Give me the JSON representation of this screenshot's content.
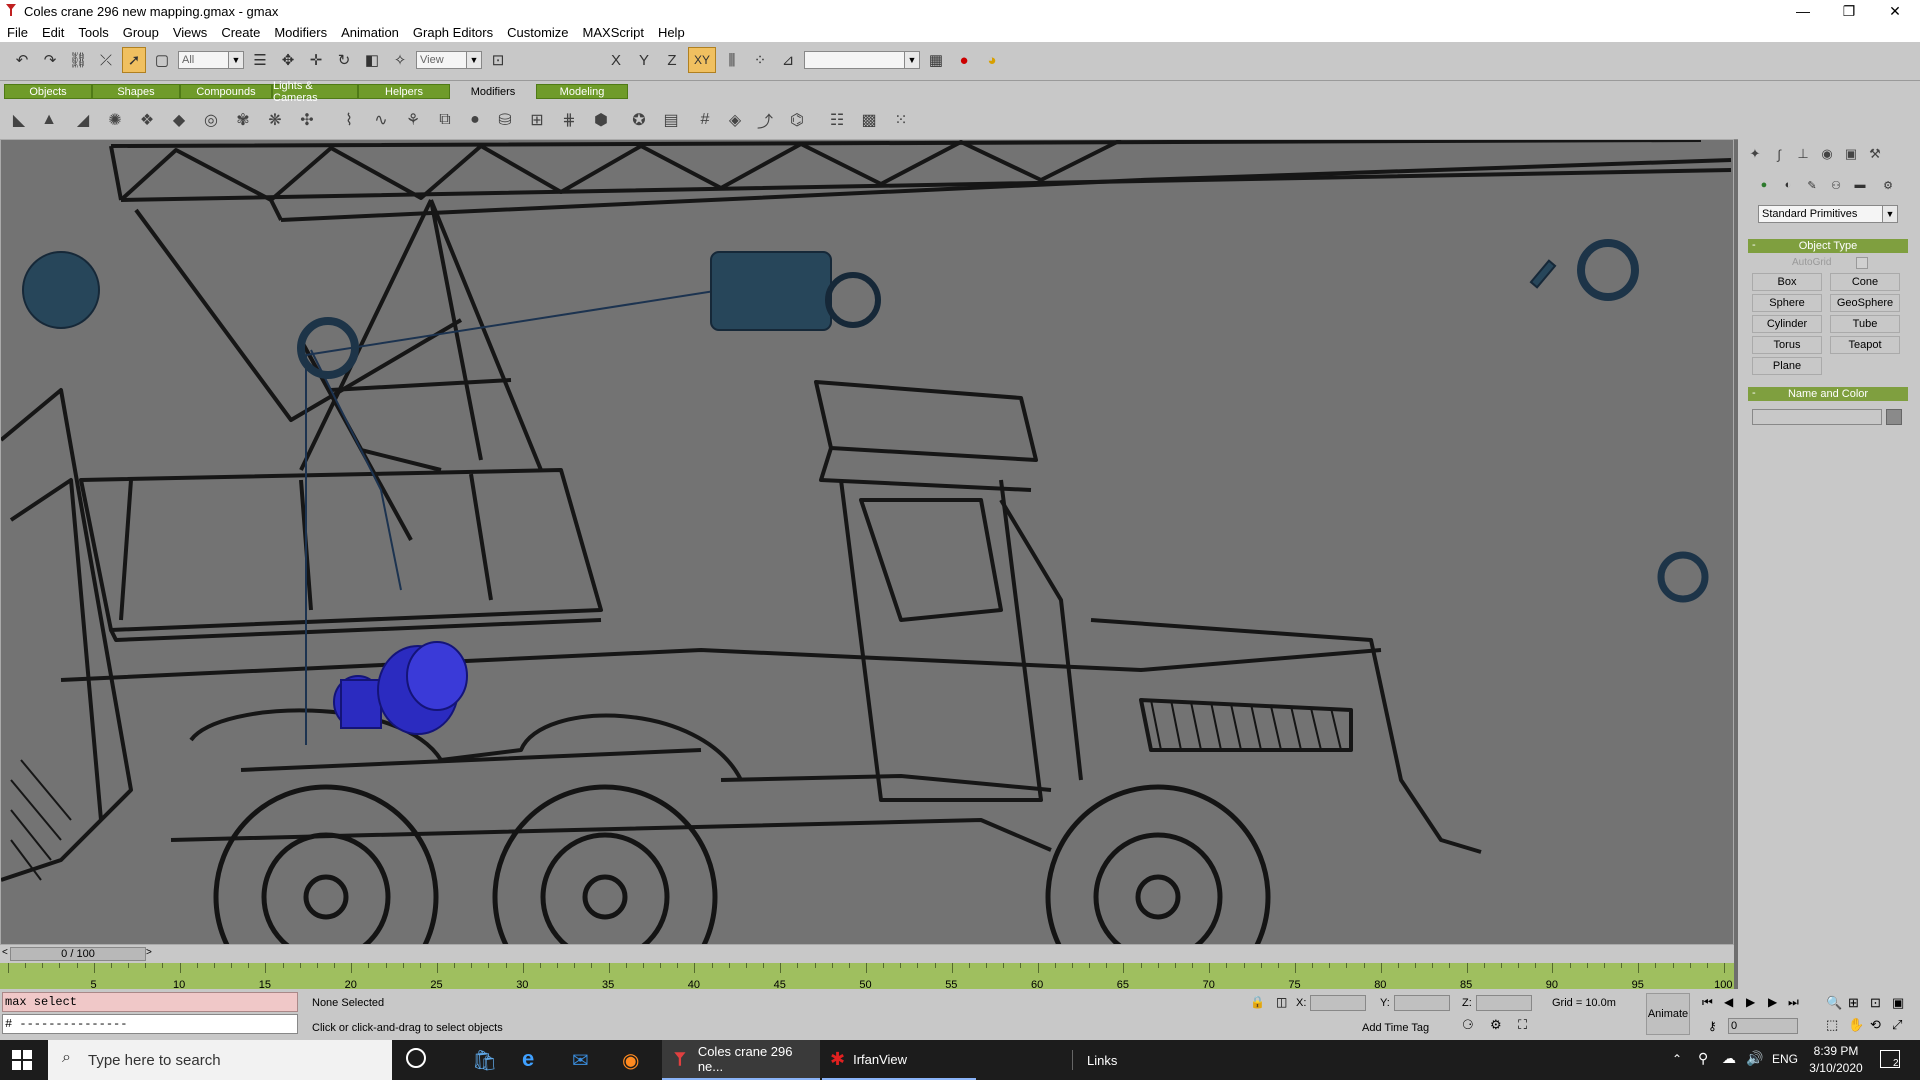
{
  "window": {
    "title": "Coles crane 296 new mapping.gmax - gmax",
    "minimize": "—",
    "restore": "❐",
    "close": "✕"
  },
  "menu": [
    "File",
    "Edit",
    "Tools",
    "Group",
    "Views",
    "Create",
    "Modifiers",
    "Animation",
    "Graph Editors",
    "Customize",
    "MAXScript",
    "Help"
  ],
  "toolbar": {
    "selection_filter": "All",
    "ref_coord": "View",
    "axis_x": "X",
    "axis_y": "Y",
    "axis_z": "Z",
    "axis_xy": "XY",
    "named_selection": ""
  },
  "tabs": [
    "Objects",
    "Shapes",
    "Compounds",
    "Lights & Cameras",
    "Helpers",
    "Modifiers",
    "Modeling"
  ],
  "selected_tab": "Modifiers",
  "command_panel": {
    "category": "Standard Primitives",
    "object_type_title": "Object Type",
    "autogrid_label": "AutoGrid",
    "buttons": [
      "Box",
      "Cone",
      "Sphere",
      "GeoSphere",
      "Cylinder",
      "Tube",
      "Torus",
      "Teapot",
      "Plane"
    ],
    "name_color_title": "Name and Color",
    "name_value": ""
  },
  "timeline": {
    "frame_display": "0 / 100",
    "ticks": [
      "5",
      "10",
      "15",
      "20",
      "25",
      "30",
      "35",
      "40",
      "45",
      "50",
      "55",
      "60",
      "65",
      "70",
      "75",
      "80",
      "85",
      "90",
      "95",
      "100"
    ]
  },
  "status": {
    "maxscript_line1": "max select",
    "maxscript_line2": "# ---------------",
    "selection": "None Selected",
    "prompt": "Click or click-and-drag to select objects",
    "x_label": "X:",
    "y_label": "Y:",
    "z_label": "Z:",
    "grid": "Grid = 10.0m",
    "animate": "Animate",
    "add_time_tag": "Add Time Tag",
    "current_frame": "0"
  },
  "taskbar": {
    "search_placeholder": "Type here to search",
    "apps": [
      "Coles crane 296 ne...",
      "IrfanView"
    ],
    "links": "Links",
    "language": "ENG",
    "time": "8:39 PM",
    "date": "3/10/2020",
    "notifications": "2"
  }
}
